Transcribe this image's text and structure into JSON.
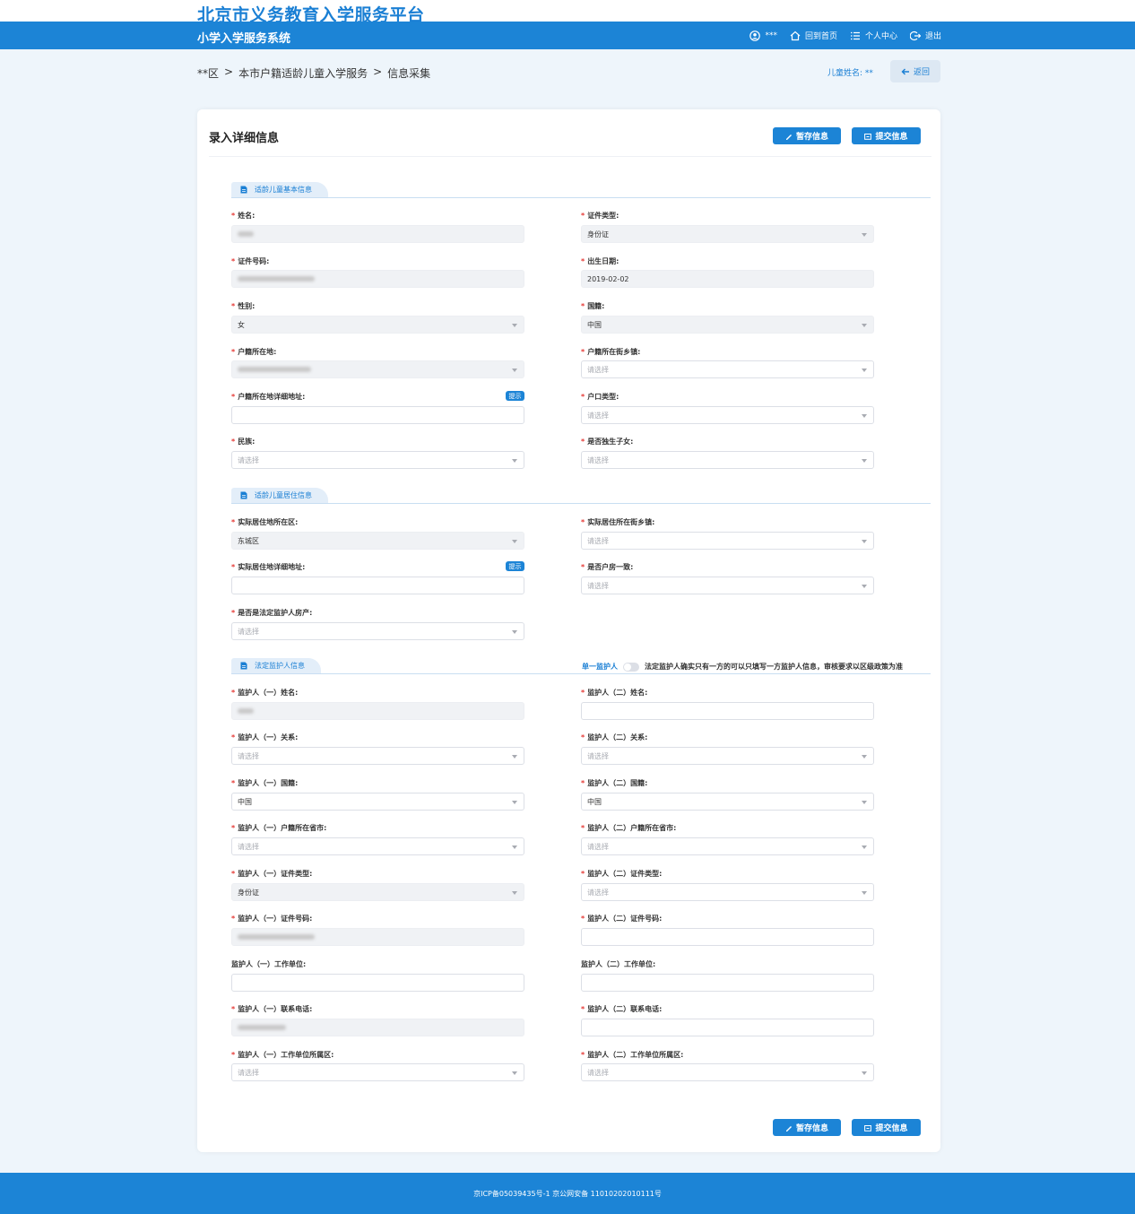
{
  "site_title": "北京市义务教育入学服务平台",
  "system_title": "小学入学服务系统",
  "nav": {
    "user": "***",
    "home": "回到首页",
    "personal": "个人中心",
    "logout": "退出"
  },
  "breadcrumb": [
    "**区",
    ">",
    "本市户籍适龄儿童入学服务",
    ">",
    "信息采集"
  ],
  "child_name": "儿童姓名: **",
  "back": "返回",
  "page": {
    "title": "录入详细信息",
    "save": "暂存信息",
    "submit": "提交信息"
  },
  "sections": {
    "basic": "适龄儿童基本信息",
    "residence": "适龄儿童居住信息",
    "guardian": "法定监护人信息"
  },
  "single_guardian": {
    "label": "单一监护人",
    "note": "法定监护人确实只有一方的可以只填写一方监护人信息，审核要求以区级政策为准"
  },
  "tip_label": "提示",
  "placeholder": "请选择",
  "fields": {
    "name": "姓名:",
    "id_type": "证件类型:",
    "id_type_value": "身份证",
    "id_number": "证件号码:",
    "birth": "出生日期:",
    "birth_value": "2019-02-02",
    "gender": "性别:",
    "gender_value": "女",
    "nationality": "国籍:",
    "nationality_value": "中国",
    "hukou_loc": "户籍所在地:",
    "hukou_street": "户籍所在街乡镇:",
    "hukou_addr": "户籍所在地详细地址:",
    "hukou_type": "户口类型:",
    "ethnicity": "民族:",
    "only_child": "是否独生子女:",
    "res_district": "实际居住地所在区:",
    "res_district_value": "东城区",
    "res_street": "实际居住所在街乡镇:",
    "res_addr": "实际居住地详细地址:",
    "same_house": "是否户房一致:",
    "guardian_property": "是否是法定监护人房产:",
    "g1_name": "监护人（一）姓名:",
    "g2_name": "监护人（二）姓名:",
    "g1_relation": "监护人（一）关系:",
    "g2_relation": "监护人（二）关系:",
    "g1_nation": "监护人（一）国籍:",
    "g2_nation": "监护人（二）国籍:",
    "g1_nation_value": "中国",
    "g2_nation_value": "中国",
    "g1_province": "监护人（一）户籍所在省市:",
    "g2_province": "监护人（二）户籍所在省市:",
    "g1_idtype": "监护人（一）证件类型:",
    "g2_idtype": "监护人（二）证件类型:",
    "g1_idtype_value": "身份证",
    "g1_idno": "监护人（一）证件号码:",
    "g2_idno": "监护人（二）证件号码:",
    "g1_work": "监护人（一）工作单位:",
    "g2_work": "监护人（二）工作单位:",
    "g1_phone": "监护人（一）联系电话:",
    "g2_phone": "监护人（二）联系电话:",
    "g1_work_district": "监护人（一）工作单位所属区:",
    "g2_work_district": "监护人（二）工作单位所属区:"
  },
  "footer": "京ICP备05039435号-1 京公网安备 11010202010111号"
}
